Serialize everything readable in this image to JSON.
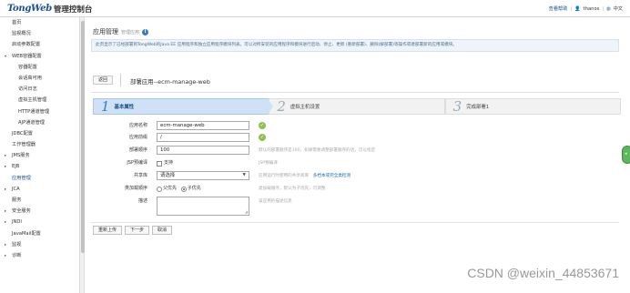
{
  "header": {
    "brand": "TongWeb",
    "subtitle": "管理控制台",
    "links": [
      "查看帮助",
      "thanos",
      "中文"
    ]
  },
  "sidebar": {
    "items": [
      {
        "label": "首页",
        "level": 1,
        "arrow": ""
      },
      {
        "label": "监视概况",
        "level": 1,
        "arrow": ""
      },
      {
        "label": "启动参数配置",
        "level": 1,
        "arrow": ""
      },
      {
        "label": "WEB容器配置",
        "level": 1,
        "arrow": "▾"
      },
      {
        "label": "容器配置",
        "level": 2,
        "arrow": ""
      },
      {
        "label": "会话高可用",
        "level": 2,
        "arrow": ""
      },
      {
        "label": "访问日志",
        "level": 2,
        "arrow": ""
      },
      {
        "label": "虚拟主机管理",
        "level": 2,
        "arrow": ""
      },
      {
        "label": "HTTP通道管理",
        "level": 2,
        "arrow": ""
      },
      {
        "label": "AJP通道管理",
        "level": 2,
        "arrow": ""
      },
      {
        "label": "JDBC配置",
        "level": 1,
        "arrow": ""
      },
      {
        "label": "工作管理器",
        "level": 1,
        "arrow": ""
      },
      {
        "label": "JMS服务",
        "level": 1,
        "arrow": "▸"
      },
      {
        "label": "EJB",
        "level": 1,
        "arrow": "▸"
      },
      {
        "label": "应用管理",
        "level": 1,
        "arrow": "",
        "active": true
      },
      {
        "label": "JCA",
        "level": 1,
        "arrow": "▸"
      },
      {
        "label": "服务",
        "level": 1,
        "arrow": ""
      },
      {
        "label": "安全服务",
        "level": 1,
        "arrow": "▸"
      },
      {
        "label": "JNDI",
        "level": 1,
        "arrow": "▸"
      },
      {
        "label": "JavaMail配置",
        "level": 1,
        "arrow": ""
      },
      {
        "label": "监视",
        "level": 1,
        "arrow": "▸"
      },
      {
        "label": "诊断",
        "level": 1,
        "arrow": "▸"
      }
    ]
  },
  "breadcrumb": {
    "title": "应用管理",
    "sub": "管理应用"
  },
  "description": "此页显示了已经部署到TongWeb的Java EE 应用程序和独立应用程序模块列表。可以对所安装的应用程序和模块进行启动、停止、更新 (重新部署)、删除(解部署)等操作或者部署新的应用或模块。",
  "back_button": "返回",
  "page_title": "部署应用--ecm-manage-web",
  "steps": [
    {
      "num": "1",
      "label": "基本属性"
    },
    {
      "num": "2",
      "label": "虚拟主机设置"
    },
    {
      "num": "3",
      "label": "完成部署1"
    }
  ],
  "form": {
    "app_name": {
      "label": "应用名称",
      "value": "ecm-manage-web"
    },
    "app_prefix": {
      "label": "应用前缀",
      "value": "/"
    },
    "deploy_order": {
      "label": "部署顺序",
      "value": "100",
      "hint": "默认的部署顺序是100，如果需要调整部署顺序的话，可以指定"
    },
    "jsp_precompile": {
      "label": "JSP预编译",
      "option": "支持",
      "hint": "JSP预编译"
    },
    "shared_lib": {
      "label": "共享库",
      "selected": "请选择",
      "hint": "应用运行时使用的共享库库",
      "link": "多档本或完全类检测"
    },
    "class_load_order": {
      "label": "类加载顺序",
      "options": [
        "父优先",
        "子优先"
      ],
      "hint": "类加载顺序，默认为子优先，可调整"
    },
    "description": {
      "label": "描述",
      "hint": "该应用的描述信息"
    }
  },
  "buttons": [
    "重新上传",
    "下一步",
    "取消"
  ],
  "watermark": "CSDN @weixin_44853671"
}
